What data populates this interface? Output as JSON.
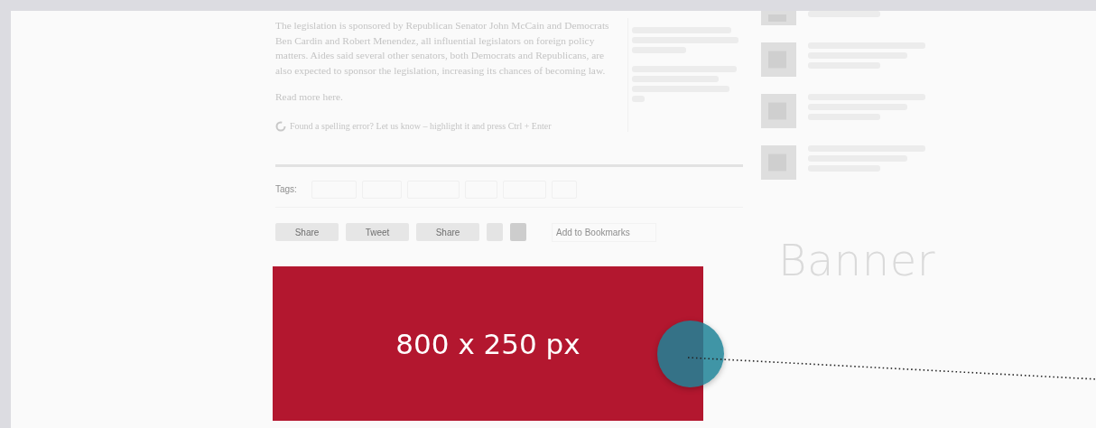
{
  "article": {
    "paragraph": "The legislation is sponsored by Republican Senator John McCain and Democrats Ben Cardin and Robert Menendez, all influential legislators on foreign policy matters. Aides said several other senators, both Democrats and Republicans, are also expected to sponsor the legislation, increasing its chances of becoming law.",
    "read_more": "Read more here.",
    "spelling_note": "Found a spelling error? Let us know – highlight it and press Ctrl + Enter"
  },
  "tags": {
    "label": "Tags:"
  },
  "share_buttons": [
    {
      "label": "Share"
    },
    {
      "label": "Tweet"
    },
    {
      "label": "Share"
    }
  ],
  "bookmark": {
    "label": "Add to Bookmarks"
  },
  "ad": {
    "size": "800 x 250 px",
    "label": "Banner"
  }
}
